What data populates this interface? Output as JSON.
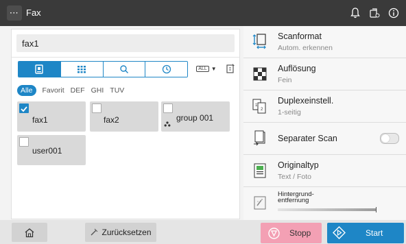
{
  "header": {
    "title": "Fax",
    "menu_label": "···",
    "icons": [
      "bell-icon",
      "fax-status-icon",
      "info-icon"
    ]
  },
  "left": {
    "search_value": "fax1",
    "tabs": [
      "index-icon",
      "grid-icon",
      "search-icon",
      "history-icon"
    ],
    "dropdown_label": "ALL",
    "filters": [
      "Alle",
      "Favorit",
      "DEF",
      "GHI",
      "TUV"
    ],
    "entries": [
      {
        "name": "fax1",
        "checked": true,
        "group": false
      },
      {
        "name": "fax2",
        "checked": false,
        "group": false
      },
      {
        "name": "group 001",
        "checked": false,
        "group": true
      },
      {
        "name": "user001",
        "checked": false,
        "group": false
      }
    ]
  },
  "right": {
    "items": [
      {
        "title": "Scanformat",
        "sub": "Autom. erkennen",
        "icon": "scan-format-icon"
      },
      {
        "title": "Auflösung",
        "sub": "Fein",
        "icon": "resolution-icon"
      },
      {
        "title": "Duplexeinstell.",
        "sub": "1-seitig",
        "icon": "duplex-icon"
      },
      {
        "title": "Separater Scan",
        "sub": "",
        "icon": "separate-scan-icon"
      },
      {
        "title": "Originaltyp",
        "sub": "Text / Foto",
        "icon": "original-type-icon"
      },
      {
        "title": "Hintergrund-\nentfernung",
        "sub": "",
        "icon": "background-removal-icon"
      }
    ]
  },
  "bottom": {
    "reset_label": "Zurücksetzen",
    "stop_label": "Stopp",
    "start_label": "Start"
  },
  "colors": {
    "accent": "#1e86c6",
    "stop": "#f3a0b4",
    "topbar": "#3a3a3a"
  }
}
